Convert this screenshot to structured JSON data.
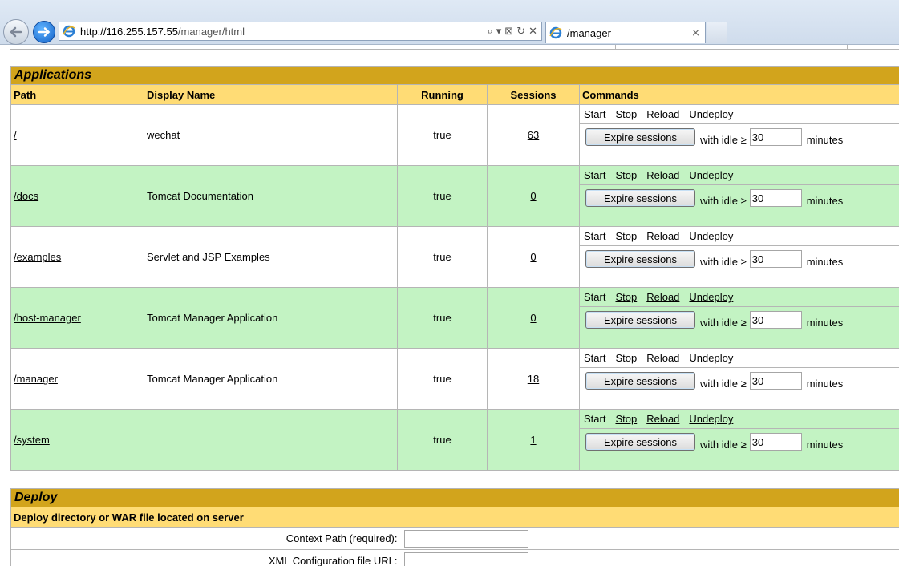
{
  "browser": {
    "url_host": "http://116.255.157.55",
    "url_path": "/manager/html",
    "tab_title": "/manager",
    "tab_close": "×",
    "tools": [
      "⌕",
      "▾",
      "⊠",
      "↻",
      "✕"
    ]
  },
  "applications": {
    "title": "Applications",
    "headers": {
      "path": "Path",
      "display_name": "Display Name",
      "running": "Running",
      "sessions": "Sessions",
      "commands": "Commands"
    },
    "rows": [
      {
        "path": "/",
        "display_name": "wechat",
        "running": "true",
        "sessions": "63",
        "cmd_start": "Start",
        "cmd_stop": "Stop",
        "cmd_reload": "Reload",
        "cmd_undeploy": "Undeploy",
        "expire_label": "Expire sessions",
        "idle_label": "with idle ≥",
        "idle_value": "30",
        "minutes_label": "minutes"
      },
      {
        "path": "/docs",
        "display_name": "Tomcat Documentation",
        "running": "true",
        "sessions": "0",
        "cmd_start": "Start",
        "cmd_stop": "Stop",
        "cmd_reload": "Reload",
        "cmd_undeploy": "Undeploy",
        "expire_label": "Expire sessions",
        "idle_label": "with idle ≥",
        "idle_value": "30",
        "minutes_label": "minutes"
      },
      {
        "path": "/examples",
        "display_name": "Servlet and JSP Examples",
        "running": "true",
        "sessions": "0",
        "cmd_start": "Start",
        "cmd_stop": "Stop",
        "cmd_reload": "Reload",
        "cmd_undeploy": "Undeploy",
        "expire_label": "Expire sessions",
        "idle_label": "with idle ≥",
        "idle_value": "30",
        "minutes_label": "minutes"
      },
      {
        "path": "/host-manager",
        "display_name": "Tomcat Manager Application",
        "running": "true",
        "sessions": "0",
        "cmd_start": "Start",
        "cmd_stop": "Stop",
        "cmd_reload": "Reload",
        "cmd_undeploy": "Undeploy",
        "expire_label": "Expire sessions",
        "idle_label": "with idle ≥",
        "idle_value": "30",
        "minutes_label": "minutes"
      },
      {
        "path": "/manager",
        "display_name": "Tomcat Manager Application",
        "running": "true",
        "sessions": "18",
        "cmd_start": "Start",
        "cmd_stop": "Stop",
        "cmd_reload": "Reload",
        "cmd_undeploy": "Undeploy",
        "expire_label": "Expire sessions",
        "idle_label": "with idle ≥",
        "idle_value": "30",
        "minutes_label": "minutes"
      },
      {
        "path": "/system",
        "display_name": "",
        "running": "true",
        "sessions": "1",
        "cmd_start": "Start",
        "cmd_stop": "Stop",
        "cmd_reload": "Reload",
        "cmd_undeploy": "Undeploy",
        "expire_label": "Expire sessions",
        "idle_label": "with idle ≥",
        "idle_value": "30",
        "minutes_label": "minutes"
      }
    ]
  },
  "deploy": {
    "title": "Deploy",
    "subtitle": "Deploy directory or WAR file located on server",
    "context_path_label": "Context Path (required):",
    "context_path_value": "",
    "xml_config_label": "XML Configuration file URL:"
  },
  "colors": {
    "title_bar": "#d2a41c",
    "header_bar": "#ffdc75",
    "row_alt": "#c3f3c3",
    "border": "#b5b5b5"
  }
}
